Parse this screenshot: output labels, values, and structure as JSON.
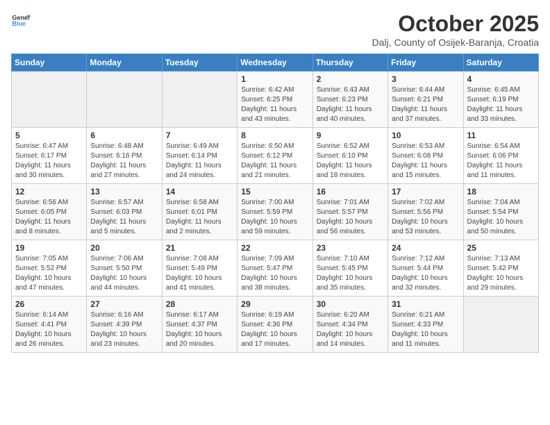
{
  "logo": {
    "general": "General",
    "blue": "Blue"
  },
  "header": {
    "month": "October 2025",
    "location": "Dalj, County of Osijek-Baranja, Croatia"
  },
  "weekdays": [
    "Sunday",
    "Monday",
    "Tuesday",
    "Wednesday",
    "Thursday",
    "Friday",
    "Saturday"
  ],
  "weeks": [
    [
      {
        "day": "",
        "info": ""
      },
      {
        "day": "",
        "info": ""
      },
      {
        "day": "",
        "info": ""
      },
      {
        "day": "1",
        "info": "Sunrise: 6:42 AM\nSunset: 6:25 PM\nDaylight: 11 hours\nand 43 minutes."
      },
      {
        "day": "2",
        "info": "Sunrise: 6:43 AM\nSunset: 6:23 PM\nDaylight: 11 hours\nand 40 minutes."
      },
      {
        "day": "3",
        "info": "Sunrise: 6:44 AM\nSunset: 6:21 PM\nDaylight: 11 hours\nand 37 minutes."
      },
      {
        "day": "4",
        "info": "Sunrise: 6:45 AM\nSunset: 6:19 PM\nDaylight: 11 hours\nand 33 minutes."
      }
    ],
    [
      {
        "day": "5",
        "info": "Sunrise: 6:47 AM\nSunset: 6:17 PM\nDaylight: 11 hours\nand 30 minutes."
      },
      {
        "day": "6",
        "info": "Sunrise: 6:48 AM\nSunset: 6:16 PM\nDaylight: 11 hours\nand 27 minutes."
      },
      {
        "day": "7",
        "info": "Sunrise: 6:49 AM\nSunset: 6:14 PM\nDaylight: 11 hours\nand 24 minutes."
      },
      {
        "day": "8",
        "info": "Sunrise: 6:50 AM\nSunset: 6:12 PM\nDaylight: 11 hours\nand 21 minutes."
      },
      {
        "day": "9",
        "info": "Sunrise: 6:52 AM\nSunset: 6:10 PM\nDaylight: 11 hours\nand 18 minutes."
      },
      {
        "day": "10",
        "info": "Sunrise: 6:53 AM\nSunset: 6:08 PM\nDaylight: 11 hours\nand 15 minutes."
      },
      {
        "day": "11",
        "info": "Sunrise: 6:54 AM\nSunset: 6:06 PM\nDaylight: 11 hours\nand 11 minutes."
      }
    ],
    [
      {
        "day": "12",
        "info": "Sunrise: 6:56 AM\nSunset: 6:05 PM\nDaylight: 11 hours\nand 8 minutes."
      },
      {
        "day": "13",
        "info": "Sunrise: 6:57 AM\nSunset: 6:03 PM\nDaylight: 11 hours\nand 5 minutes."
      },
      {
        "day": "14",
        "info": "Sunrise: 6:58 AM\nSunset: 6:01 PM\nDaylight: 11 hours\nand 2 minutes."
      },
      {
        "day": "15",
        "info": "Sunrise: 7:00 AM\nSunset: 5:59 PM\nDaylight: 10 hours\nand 59 minutes."
      },
      {
        "day": "16",
        "info": "Sunrise: 7:01 AM\nSunset: 5:57 PM\nDaylight: 10 hours\nand 56 minutes."
      },
      {
        "day": "17",
        "info": "Sunrise: 7:02 AM\nSunset: 5:56 PM\nDaylight: 10 hours\nand 53 minutes."
      },
      {
        "day": "18",
        "info": "Sunrise: 7:04 AM\nSunset: 5:54 PM\nDaylight: 10 hours\nand 50 minutes."
      }
    ],
    [
      {
        "day": "19",
        "info": "Sunrise: 7:05 AM\nSunset: 5:52 PM\nDaylight: 10 hours\nand 47 minutes."
      },
      {
        "day": "20",
        "info": "Sunrise: 7:06 AM\nSunset: 5:50 PM\nDaylight: 10 hours\nand 44 minutes."
      },
      {
        "day": "21",
        "info": "Sunrise: 7:08 AM\nSunset: 5:49 PM\nDaylight: 10 hours\nand 41 minutes."
      },
      {
        "day": "22",
        "info": "Sunrise: 7:09 AM\nSunset: 5:47 PM\nDaylight: 10 hours\nand 38 minutes."
      },
      {
        "day": "23",
        "info": "Sunrise: 7:10 AM\nSunset: 5:45 PM\nDaylight: 10 hours\nand 35 minutes."
      },
      {
        "day": "24",
        "info": "Sunrise: 7:12 AM\nSunset: 5:44 PM\nDaylight: 10 hours\nand 32 minutes."
      },
      {
        "day": "25",
        "info": "Sunrise: 7:13 AM\nSunset: 5:42 PM\nDaylight: 10 hours\nand 29 minutes."
      }
    ],
    [
      {
        "day": "26",
        "info": "Sunrise: 6:14 AM\nSunset: 4:41 PM\nDaylight: 10 hours\nand 26 minutes."
      },
      {
        "day": "27",
        "info": "Sunrise: 6:16 AM\nSunset: 4:39 PM\nDaylight: 10 hours\nand 23 minutes."
      },
      {
        "day": "28",
        "info": "Sunrise: 6:17 AM\nSunset: 4:37 PM\nDaylight: 10 hours\nand 20 minutes."
      },
      {
        "day": "29",
        "info": "Sunrise: 6:19 AM\nSunset: 4:36 PM\nDaylight: 10 hours\nand 17 minutes."
      },
      {
        "day": "30",
        "info": "Sunrise: 6:20 AM\nSunset: 4:34 PM\nDaylight: 10 hours\nand 14 minutes."
      },
      {
        "day": "31",
        "info": "Sunrise: 6:21 AM\nSunset: 4:33 PM\nDaylight: 10 hours\nand 11 minutes."
      },
      {
        "day": "",
        "info": ""
      }
    ]
  ]
}
